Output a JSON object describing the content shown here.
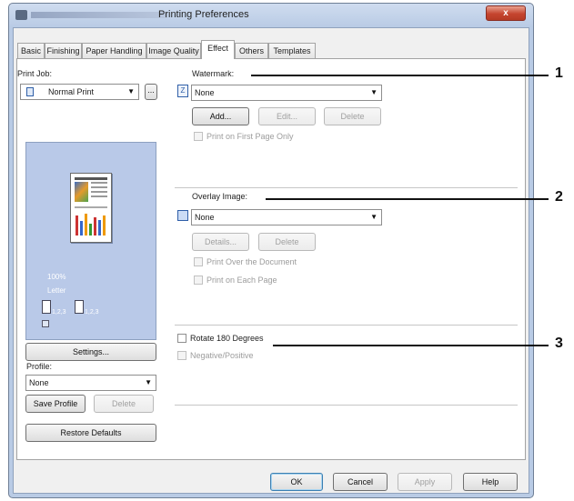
{
  "window": {
    "title": "Printing Preferences",
    "close_label": "x"
  },
  "tabs": [
    "Basic",
    "Finishing",
    "Paper Handling",
    "Image Quality",
    "Effect",
    "Others",
    "Templates"
  ],
  "active_tab": "Effect",
  "left": {
    "print_job_label": "Print Job:",
    "print_job_value": "Normal Print",
    "print_job_more": "...",
    "preview": {
      "zoom": "100%",
      "paper": "Letter",
      "collate_a": "1,2,3",
      "collate_b": "1,2,3"
    },
    "settings_button": "Settings...",
    "profile_label": "Profile:",
    "profile_value": "None",
    "save_profile_button": "Save Profile",
    "delete_button": "Delete",
    "restore_defaults_button": "Restore Defaults"
  },
  "watermark": {
    "label": "Watermark:",
    "value": "None",
    "add_button": "Add...",
    "edit_button": "Edit...",
    "delete_button": "Delete",
    "first_page_only": "Print on First Page Only"
  },
  "overlay": {
    "label": "Overlay Image:",
    "value": "None",
    "details_button": "Details...",
    "delete_button": "Delete",
    "over_document": "Print Over the Document",
    "each_page": "Print on Each Page"
  },
  "rotate_180": "Rotate 180 Degrees",
  "negative_positive": "Negative/Positive",
  "footer": {
    "ok": "OK",
    "cancel": "Cancel",
    "apply": "Apply",
    "help": "Help"
  },
  "callouts": [
    "1",
    "2",
    "3"
  ]
}
